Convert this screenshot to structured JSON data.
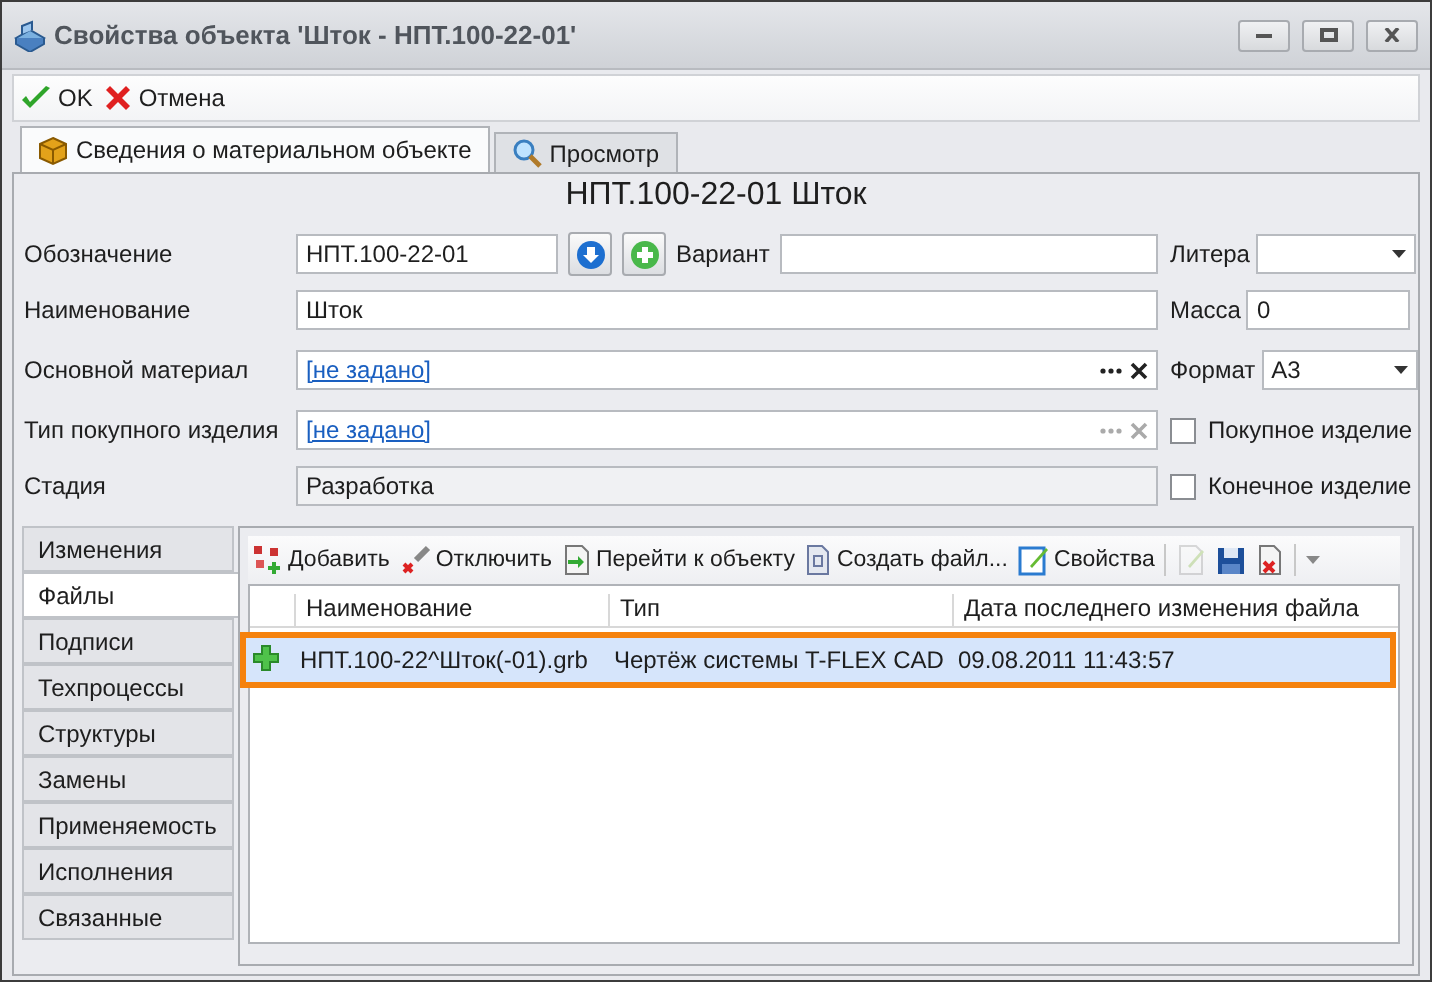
{
  "window": {
    "title": "Свойства объекта 'Шток - НПТ.100-22-01'"
  },
  "toolbar": [
    {
      "kind": "ok",
      "label": "OK"
    },
    {
      "kind": "cancel",
      "label": "Отмена"
    }
  ],
  "tabs": [
    {
      "kind": "box",
      "label": "Сведения о материальном объекте",
      "selected": true
    },
    {
      "kind": "magnifier",
      "label": "Просмотр",
      "selected": false
    }
  ],
  "heading": "НПТ.100-22-01 Шток",
  "form": {
    "designation": {
      "label": "Обозначение",
      "value": "НПТ.100-22-01"
    },
    "variant": {
      "label": "Вариант"
    },
    "litera": {
      "label": "Литера"
    },
    "name": {
      "label": "Наименование",
      "value": "Шток"
    },
    "mass": {
      "label": "Масса",
      "value": "0"
    },
    "material": {
      "label": "Основной материал",
      "value": "[не задано]",
      "disabled": false
    },
    "format": {
      "label": "Формат",
      "value": "А3"
    },
    "purchase_type": {
      "label": "Тип покупного изделия",
      "value": "[не задано]",
      "disabled": true
    },
    "stage": {
      "label": "Стадия",
      "value": "Разработка"
    },
    "checkboxes": [
      {
        "label": "Покупное изделие",
        "checked": false
      },
      {
        "label": "Конечное изделие",
        "checked": false
      }
    ]
  },
  "side_tabs": [
    {
      "label": "Изменения",
      "selected": false
    },
    {
      "label": "Файлы",
      "selected": true
    },
    {
      "label": "Подписи",
      "selected": false
    },
    {
      "label": "Техпроцессы",
      "selected": false
    },
    {
      "label": "Структуры",
      "selected": false
    },
    {
      "label": "Замены",
      "selected": false
    },
    {
      "label": "Применяемость",
      "selected": false
    },
    {
      "label": "Исполнения",
      "selected": false
    },
    {
      "label": "Связанные",
      "selected": false
    }
  ],
  "files_toolbar": [
    {
      "kind": "add",
      "label": "Добавить"
    },
    {
      "kind": "unlink",
      "label": "Отключить"
    },
    {
      "kind": "goto",
      "label": "Перейти к объекту"
    },
    {
      "kind": "create",
      "label": "Создать файл..."
    },
    {
      "kind": "properties",
      "label": "Свойства"
    }
  ],
  "files_icon_buttons": [
    {
      "kind": "edit",
      "disabled": true
    },
    {
      "kind": "save",
      "disabled": false
    },
    {
      "kind": "delete",
      "disabled": false
    }
  ],
  "table": {
    "columns": [
      "Наименование",
      "Тип",
      "Дата последнего изменения файла"
    ],
    "rows": [
      {
        "cells": [
          "НПТ.100-22^Шток(-01).grb",
          "Чертёж системы T-FLEX CAD",
          "09.08.2011 11:43:57"
        ],
        "selected": true
      }
    ]
  }
}
